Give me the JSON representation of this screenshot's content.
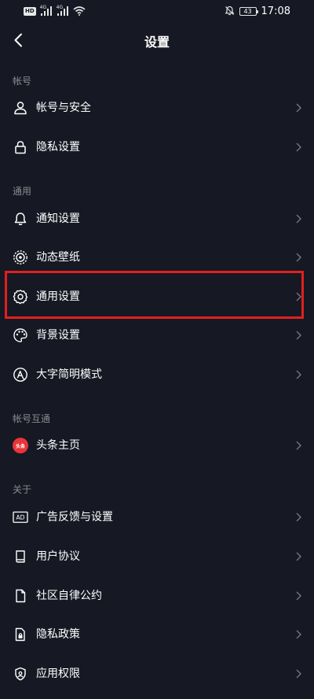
{
  "status_bar": {
    "hd_badge": "HD",
    "sim1_tag": "4G",
    "sim2_tag": "4G",
    "battery": "43",
    "time": "17:08",
    "icons": [
      "hd-icon",
      "signal-icon",
      "signal-icon",
      "wifi-icon",
      "mute-bell-icon",
      "battery-icon"
    ]
  },
  "header": {
    "title": "设置",
    "back_icon": "chevron-left-icon"
  },
  "sections": [
    {
      "label": "帐号",
      "items": [
        {
          "label": "帐号与安全",
          "icon": "user-icon"
        },
        {
          "label": "隐私设置",
          "icon": "lock-icon"
        }
      ]
    },
    {
      "label": "通用",
      "items": [
        {
          "label": "通知设置",
          "icon": "bell-icon"
        },
        {
          "label": "动态壁纸",
          "icon": "wallpaper-icon"
        },
        {
          "label": "通用设置",
          "icon": "gear-icon"
        },
        {
          "label": "背景设置",
          "icon": "palette-icon"
        },
        {
          "label": "大字简明模式",
          "icon": "large-font-icon"
        }
      ]
    },
    {
      "label": "帐号互通",
      "items": [
        {
          "label": "头条主页",
          "icon": "toutiao-logo-icon",
          "logo_text": "头条"
        }
      ]
    },
    {
      "label": "关于",
      "items": [
        {
          "label": "广告反馈与设置",
          "icon": "ad-icon",
          "icon_text": "AD"
        },
        {
          "label": "用户协议",
          "icon": "book-icon"
        },
        {
          "label": "社区自律公约",
          "icon": "document-icon"
        },
        {
          "label": "隐私政策",
          "icon": "privacy-policy-icon"
        },
        {
          "label": "应用权限",
          "icon": "shield-icon"
        }
      ]
    }
  ],
  "highlight": {
    "target": "通用设置",
    "color": "#e0201e"
  },
  "colors": {
    "background": "#161823",
    "text": "#ffffff",
    "section_label": "#8a8b91",
    "chevron": "#75767c"
  }
}
